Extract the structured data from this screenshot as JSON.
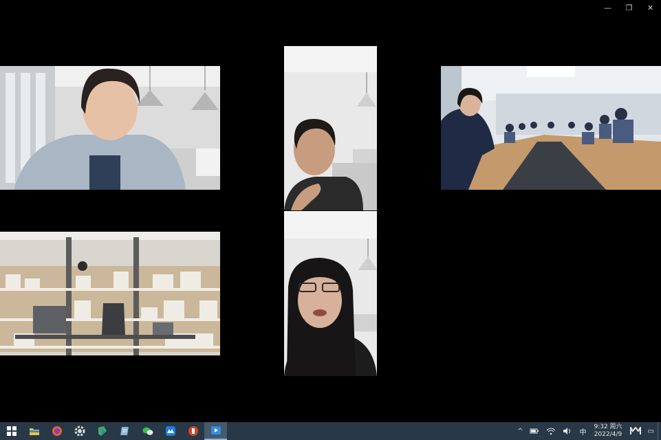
{
  "window": {
    "minimize_glyph": "—",
    "restore_glyph": "❐",
    "close_glyph": "✕"
  },
  "participants": [
    {
      "tile": "participant-video-1",
      "scene": "office-with-pendant-lamps"
    },
    {
      "tile": "participant-video-2",
      "scene": "white-office-portrait"
    },
    {
      "tile": "participant-video-3",
      "scene": "conference-room-meeting"
    },
    {
      "tile": "participant-video-4",
      "scene": "virtual-bookshelf-background"
    },
    {
      "tile": "participant-video-5",
      "scene": "white-office-portrait"
    }
  ],
  "taskbar": {
    "apps": [
      {
        "name": "start-button",
        "icon": "windows-logo-icon",
        "color": "#ffffff"
      },
      {
        "name": "file-explorer",
        "icon": "folder-icon",
        "color": "#f2c335"
      },
      {
        "name": "firefox",
        "icon": "firefox-icon",
        "color": "#e8632b"
      },
      {
        "name": "settings-app",
        "icon": "gear-icon",
        "color": "#d9d9d9"
      },
      {
        "name": "app-green",
        "icon": "sheets-icon",
        "color": "#3fae62"
      },
      {
        "name": "app-notes",
        "icon": "notes-icon",
        "color": "#8fb4d3"
      },
      {
        "name": "wechat",
        "icon": "wechat-icon",
        "color": "#2dc24e"
      },
      {
        "name": "app-blue",
        "icon": "meeting-icon",
        "color": "#1d7fe0"
      },
      {
        "name": "powerpoint",
        "icon": "presentation-icon",
        "color": "#d24726"
      },
      {
        "name": "video-player",
        "icon": "video-player-icon",
        "color": "#2f8fe0"
      }
    ],
    "tray": {
      "chevron": "^",
      "ime": "中",
      "time": "9:32 周六",
      "date": "2022/4/9",
      "notification_glyph": "▭"
    }
  }
}
